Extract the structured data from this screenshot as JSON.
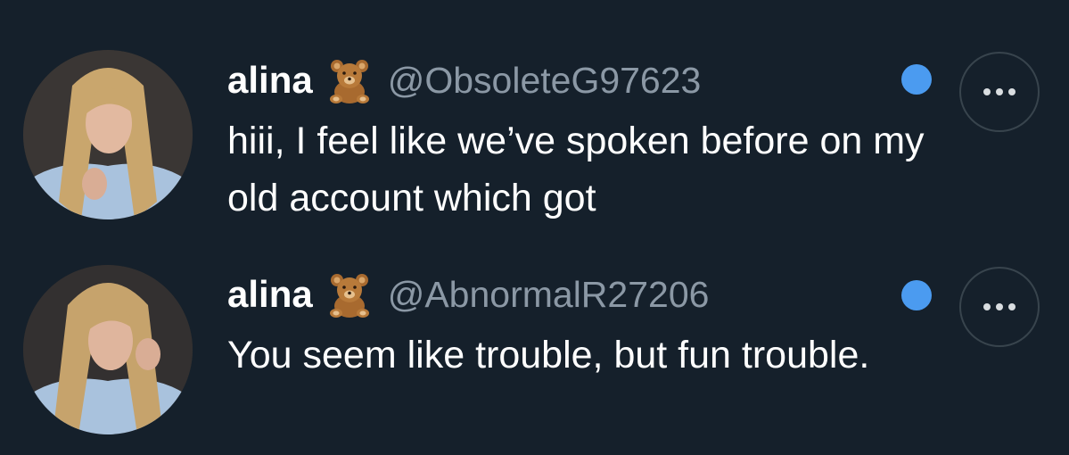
{
  "messages": [
    {
      "name": "alina",
      "emoji": "teddy-bear",
      "handle": "@ObsoleteG97623",
      "text": "hiii, I feel like we’ve spoken before on my old account which got",
      "unread": true
    },
    {
      "name": "alina",
      "emoji": "teddy-bear",
      "handle": "@AbnormalR27206",
      "text": "You seem like trouble, but fun trouble.",
      "unread": true
    }
  ],
  "colors": {
    "background": "#15202b",
    "name": "#ffffff",
    "handle": "#8b98a5",
    "unread_dot": "#4b9bf0",
    "button_border": "#38444d"
  },
  "icons": {
    "unread": "unread-dot-icon",
    "more": "more-options-icon",
    "emoji": "teddy-bear-icon"
  }
}
